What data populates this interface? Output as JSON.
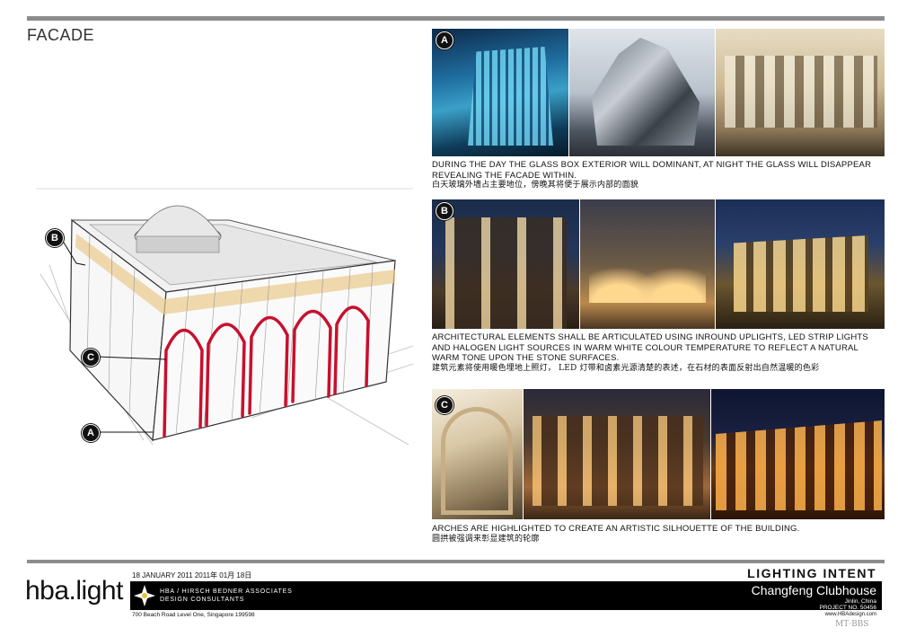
{
  "page": {
    "title": "FACADE"
  },
  "markers": {
    "a": "A",
    "b": "B",
    "c": "C"
  },
  "sections": [
    {
      "id": "A",
      "caption_en": "DURING THE DAY THE GLASS BOX EXTERIOR WILL DOMINANT, AT NIGHT THE GLASS WILL DISAPPEAR REVEALING THE FACADE WITHIN.",
      "caption_zh": "白天玻璃外墙占主要地位，傍晚其将便于展示内部的面貌"
    },
    {
      "id": "B",
      "caption_en": "ARCHITECTURAL ELEMENTS SHALL BE ARTICULATED USING INROUND UPLIGHTS, LED STRIP LIGHTS AND HALOGEN LIGHT SOURCES IN WARM WHITE COLOUR TEMPERATURE TO REFLECT A NATURAL WARM TONE UPON THE STONE SURFACES.",
      "caption_zh": "建筑元素将使用暖色埋地上照灯， LED 灯带和卤素光源清楚的表述，在石材的表面反射出自然温暖的色彩"
    },
    {
      "id": "C",
      "caption_en": "ARCHES ARE HIGHLIGHTED TO CREATE AN ARTISTIC SILHOUETTE OF THE BUILDING.",
      "caption_zh": "圆拱被强调来彰显建筑的轮廓"
    }
  ],
  "footer": {
    "logo": "hba.light",
    "date": "18 JANUARY 2011   2011年 01月 18日",
    "company_line1": "HBA / HIRSCH BEDNER ASSOCIATES",
    "company_line2": "DESIGN CONSULTANTS",
    "address": "700 Beach Road Level One, Singapore 199598",
    "heading": "LIGHTING INTENT",
    "project": "Changfeng Clubhouse",
    "location": "Jinlin, China",
    "project_no": "PROJECT NO. 50456",
    "website": "www.HBAdesign.com",
    "watermark": "MT·BBS"
  },
  "colors": {
    "rule": "#8c8c8c",
    "arch": "#c8102e",
    "glow": "#e9c98a",
    "band": "#000000"
  }
}
